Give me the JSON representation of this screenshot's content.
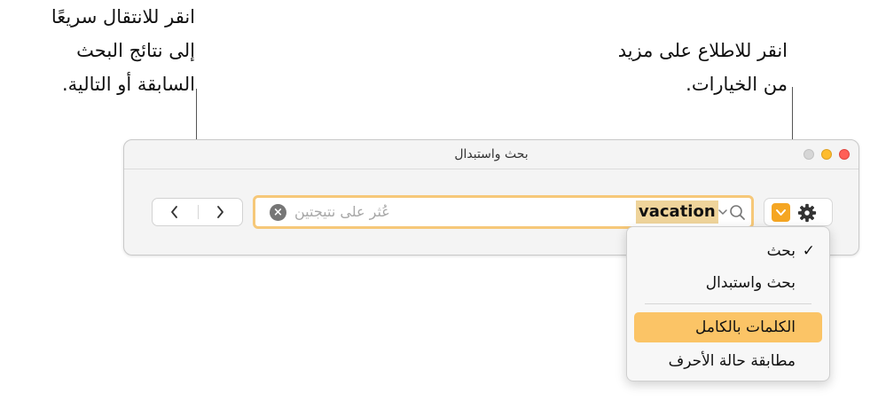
{
  "callouts": {
    "nav": {
      "line1": "انقر للانتقال سريعًا",
      "line2": "إلى نتائج البحث",
      "line3": "السابقة أو التالية."
    },
    "options": {
      "line1": "انقر للاطلاع على مزيد",
      "line2": "من الخيارات."
    }
  },
  "window": {
    "title": "بحث واستبدال"
  },
  "nav": {
    "prev_glyph": "‹",
    "next_glyph": "›"
  },
  "search": {
    "query": "vacation",
    "placeholder": "عُثر على نتيجتين",
    "clear_glyph": "×"
  },
  "menu": {
    "items": [
      {
        "label": "بحث",
        "checked": true
      },
      {
        "label": "بحث واستبدال",
        "checked": false
      },
      {
        "label": "الكلمات بالكامل",
        "highlighted": true
      },
      {
        "label": "مطابقة حالة الأحرف",
        "highlighted": false
      }
    ],
    "check_glyph": "✓"
  },
  "colors": {
    "accent": "#f5a623",
    "highlight": "#fbc466",
    "search_border": "#f6c879",
    "query_highlight": "#efd49b"
  }
}
